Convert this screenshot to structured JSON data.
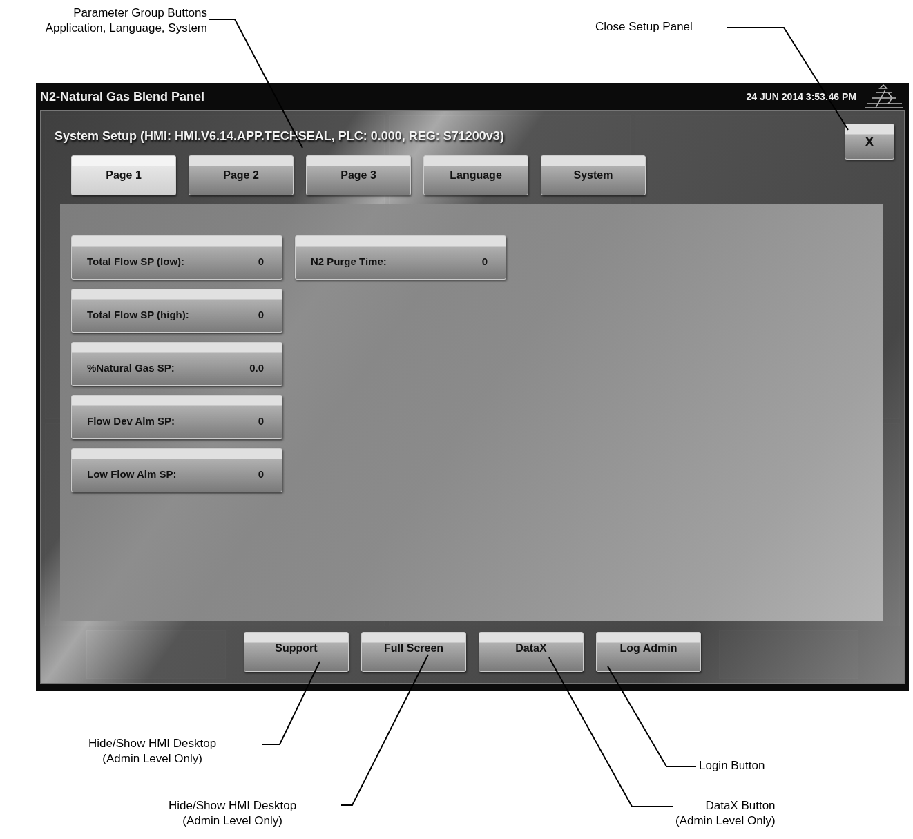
{
  "header": {
    "title": "N2-Natural Gas Blend Panel",
    "datetime": "24 JUN 2014 3:53:46 PM"
  },
  "setup_dialog": {
    "title": "System Setup (HMI: HMI.V6.14.APP.TECHSEAL, PLC: 0.000, REG: S71200v3)",
    "close_label": "X",
    "tabs": [
      {
        "label": "Page 1",
        "selected": true
      },
      {
        "label": "Page 2",
        "selected": false
      },
      {
        "label": "Page 3",
        "selected": false
      },
      {
        "label": "Language",
        "selected": false
      },
      {
        "label": "System",
        "selected": false
      }
    ],
    "parameter_columns": [
      [
        {
          "label": "Total Flow SP (low):",
          "value": "0"
        },
        {
          "label": "Total Flow SP (high):",
          "value": "0"
        },
        {
          "label": "%Natural Gas SP:",
          "value": "0.0"
        },
        {
          "label": "Flow Dev Alm SP:",
          "value": "0"
        },
        {
          "label": "Low Flow Alm SP:",
          "value": "0"
        }
      ],
      [
        {
          "label": "N2 Purge Time:",
          "value": "0"
        }
      ]
    ],
    "buttons": [
      "Support",
      "Full Screen",
      "DataX",
      "Log Admin"
    ]
  },
  "annotations": [
    {
      "text": "Parameter Group Buttons\nApplication, Language, System"
    },
    {
      "text": "Close Setup Panel"
    },
    {
      "text": "Hide/Show HMI Desktop\n(Admin Level Only)"
    },
    {
      "text": "Hide/Show HMI Desktop\n(Admin Level Only)"
    },
    {
      "text": "Login Button"
    },
    {
      "text": "DataX Button\n(Admin Level Only)"
    }
  ]
}
